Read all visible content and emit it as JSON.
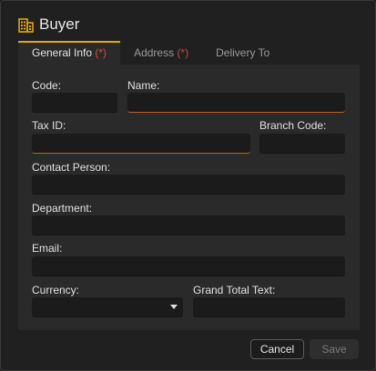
{
  "dialog": {
    "title": "Buyer",
    "icon": "building-icon",
    "accent_color": "#e2a414",
    "error_color": "#c35f22"
  },
  "tabs": [
    {
      "label": "General Info",
      "required_mark": "(*)",
      "active": true
    },
    {
      "label": "Address",
      "required_mark": "(*)",
      "active": false
    },
    {
      "label": "Delivery To",
      "required_mark": "",
      "active": false
    }
  ],
  "form": {
    "code": {
      "label": "Code:",
      "value": ""
    },
    "name": {
      "label": "Name:",
      "value": ""
    },
    "tax_id": {
      "label": "Tax ID:",
      "value": ""
    },
    "branch_code": {
      "label": "Branch Code:",
      "value": ""
    },
    "contact_person": {
      "label": "Contact Person:",
      "value": ""
    },
    "department": {
      "label": "Department:",
      "value": ""
    },
    "email": {
      "label": "Email:",
      "value": ""
    },
    "currency": {
      "label": "Currency:",
      "value": ""
    },
    "grand_total_text": {
      "label": "Grand Total Text:",
      "value": ""
    }
  },
  "buttons": {
    "cancel": "Cancel",
    "save": "Save"
  }
}
